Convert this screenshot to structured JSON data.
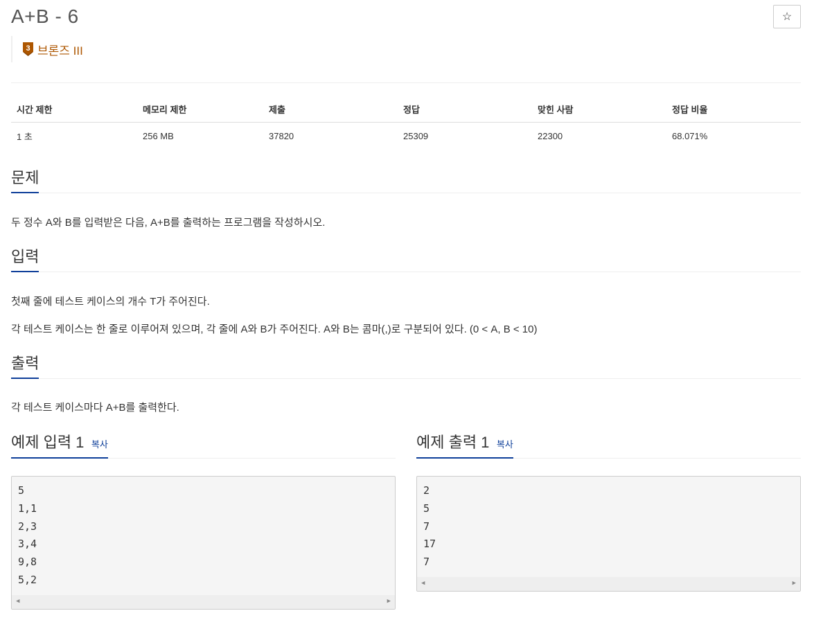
{
  "problem": {
    "title": "A+B - 6",
    "star_label": "☆",
    "tier_number": "3",
    "tier_text": "브론즈 III"
  },
  "info_table": {
    "headers": [
      "시간 제한",
      "메모리 제한",
      "제출",
      "정답",
      "맞힌 사람",
      "정답 비율"
    ],
    "values": [
      "1 초",
      "256 MB",
      "37820",
      "25309",
      "22300",
      "68.071%"
    ]
  },
  "sections": {
    "problem_heading": "문제",
    "problem_text": "두 정수 A와 B를 입력받은 다음, A+B를 출력하는 프로그램을 작성하시오.",
    "input_heading": "입력",
    "input_text_1": "첫째 줄에 테스트 케이스의 개수 T가 주어진다.",
    "input_text_2": "각 테스트 케이스는 한 줄로 이루어져 있으며, 각 줄에 A와 B가 주어진다. A와 B는 콤마(,)로 구분되어 있다. (0 < A, B < 10)",
    "output_heading": "출력",
    "output_text": "각 테스트 케이스마다 A+B를 출력한다."
  },
  "samples": {
    "input_heading": "예제 입력 1",
    "output_heading": "예제 출력 1",
    "copy_label": "복사",
    "input_lines": "5\n1,1\n2,3\n3,4\n9,8\n5,2",
    "output_lines": "2\n5\n7\n17\n7"
  },
  "colors": {
    "tier_bronze": "#ad5600",
    "heading_underline": "#0d3e99",
    "copy_link": "#0d3e99"
  }
}
